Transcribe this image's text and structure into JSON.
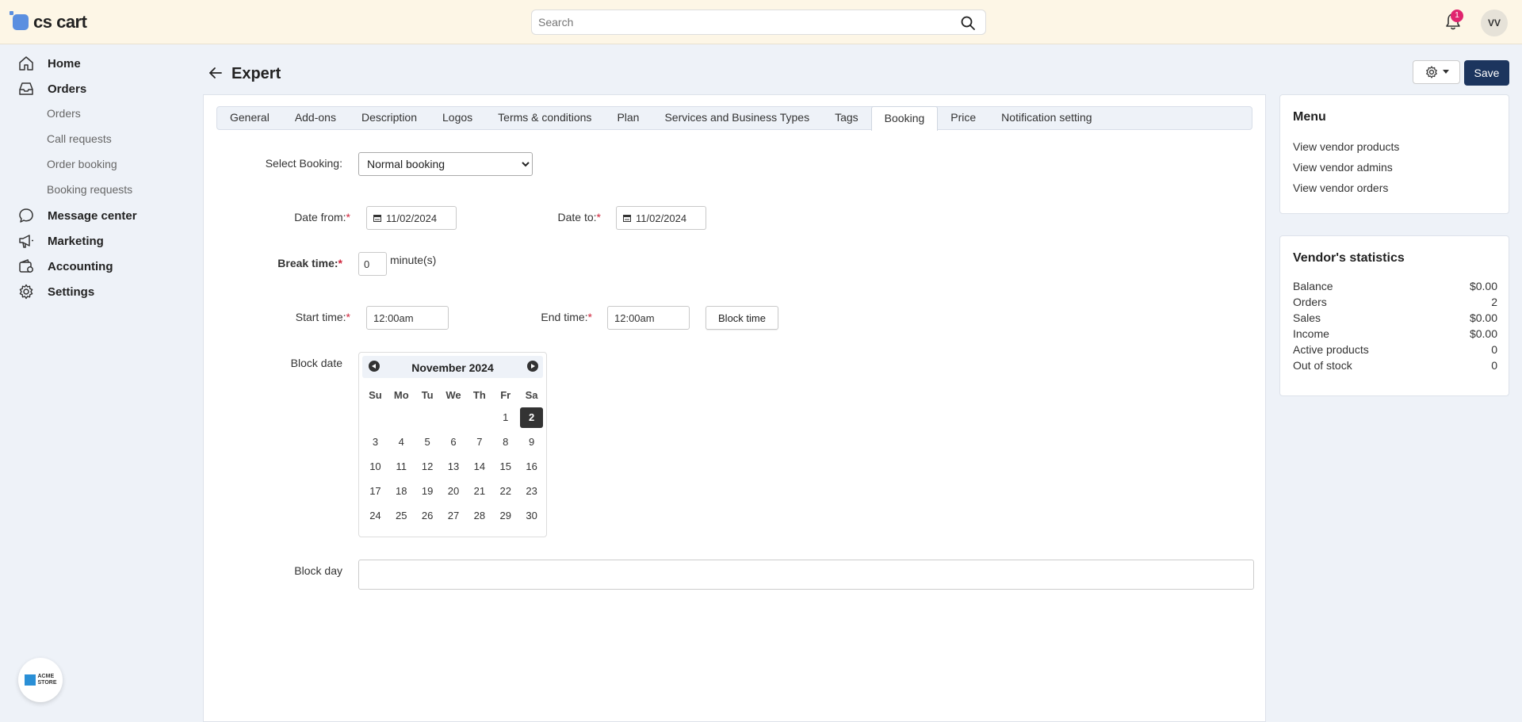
{
  "app": {
    "logo_text": "cs cart"
  },
  "search": {
    "placeholder": "Search"
  },
  "notifications": {
    "count": "1"
  },
  "user": {
    "initials": "VV"
  },
  "sidebar": {
    "items": [
      {
        "label": "Home",
        "icon": "home-icon"
      },
      {
        "label": "Orders",
        "icon": "inbox-icon"
      },
      {
        "label": "Message center",
        "icon": "chat-icon"
      },
      {
        "label": "Marketing",
        "icon": "megaphone-icon"
      },
      {
        "label": "Accounting",
        "icon": "wallet-icon"
      },
      {
        "label": "Settings",
        "icon": "gear-icon"
      }
    ],
    "orders_sub": [
      "Orders",
      "Call requests",
      "Order booking",
      "Booking requests"
    ],
    "store_badge": {
      "line1": "ACME",
      "line2": "STORE"
    }
  },
  "header": {
    "title": "Expert",
    "save_label": "Save"
  },
  "tabs": [
    {
      "label": "General"
    },
    {
      "label": "Add-ons"
    },
    {
      "label": "Description"
    },
    {
      "label": "Logos"
    },
    {
      "label": "Terms & conditions"
    },
    {
      "label": "Plan"
    },
    {
      "label": "Services and Business Types"
    },
    {
      "label": "Tags"
    },
    {
      "label": "Booking",
      "active": true
    },
    {
      "label": "Price"
    },
    {
      "label": "Notification setting"
    }
  ],
  "form": {
    "select_booking": {
      "label": "Select Booking:",
      "value": "Normal booking",
      "options": [
        "Normal booking"
      ]
    },
    "date_from": {
      "label": "Date from:",
      "value": "11/02/2024"
    },
    "date_to": {
      "label": "Date to:",
      "value": "11/02/2024"
    },
    "break_time": {
      "label": "Break time:",
      "value": "0",
      "unit": "minute(s)"
    },
    "start_time": {
      "label": "Start time:",
      "value": "12:00am"
    },
    "end_time": {
      "label": "End time:",
      "value": "12:00am"
    },
    "block_time_label": "Block time",
    "block_date_label": "Block date",
    "block_day_label": "Block day",
    "required_mark": "*"
  },
  "datepicker": {
    "title": "November 2024",
    "weekdays": [
      "Su",
      "Mo",
      "Tu",
      "We",
      "Th",
      "Fr",
      "Sa"
    ],
    "weeks": [
      [
        "",
        "",
        "",
        "",
        "",
        "1",
        "2"
      ],
      [
        "3",
        "4",
        "5",
        "6",
        "7",
        "8",
        "9"
      ],
      [
        "10",
        "11",
        "12",
        "13",
        "14",
        "15",
        "16"
      ],
      [
        "17",
        "18",
        "19",
        "20",
        "21",
        "22",
        "23"
      ],
      [
        "24",
        "25",
        "26",
        "27",
        "28",
        "29",
        "30"
      ]
    ],
    "selected": "2"
  },
  "menu_card": {
    "title": "Menu",
    "links": [
      "View vendor products",
      "View vendor admins",
      "View vendor orders"
    ]
  },
  "stats_card": {
    "title": "Vendor's statistics",
    "rows": [
      {
        "label": "Balance",
        "value": "$0.00"
      },
      {
        "label": "Orders",
        "value": "2"
      },
      {
        "label": "Sales",
        "value": "$0.00"
      },
      {
        "label": "Income",
        "value": "$0.00"
      },
      {
        "label": "Active products",
        "value": "0"
      },
      {
        "label": "Out of stock",
        "value": "0"
      }
    ]
  },
  "colors": {
    "topbar": "#fdf6e6",
    "primary": "#1c355e",
    "required": "#d0243b",
    "badge": "#e0246e"
  }
}
